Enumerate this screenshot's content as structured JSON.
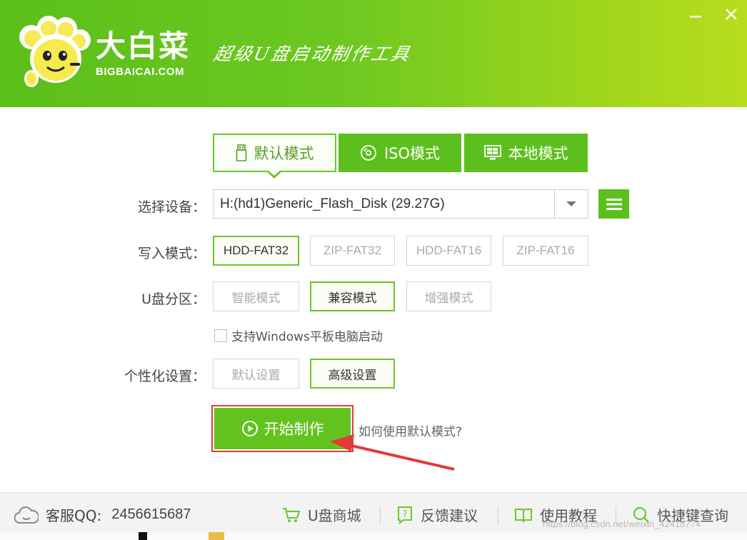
{
  "header": {
    "logo_cn": "大白菜",
    "logo_en": "BIGBAICAI.COM",
    "slogan": "超级U盘启动制作工具",
    "icons": {
      "minimize": "minimize-icon",
      "close": "close-icon"
    }
  },
  "tabs": [
    {
      "label": "默认模式",
      "icon": "usb-drive-icon",
      "selected": true
    },
    {
      "label": "ISO模式",
      "icon": "disc-icon",
      "selected": false
    },
    {
      "label": "本地模式",
      "icon": "monitor-icon",
      "selected": false
    }
  ],
  "device": {
    "label": "选择设备：",
    "value": "H:(hd1)Generic_Flash_Disk (29.27G)"
  },
  "write_mode": {
    "label": "写入模式：",
    "options": [
      "HDD-FAT32",
      "ZIP-FAT32",
      "HDD-FAT16",
      "ZIP-FAT16"
    ],
    "selected": "HDD-FAT32"
  },
  "partition": {
    "label": "U盘分区：",
    "options": [
      "智能模式",
      "兼容模式",
      "增强模式"
    ],
    "selected": "兼容模式"
  },
  "tablet_boot": {
    "label": "支持Windows平板电脑启动",
    "checked": false
  },
  "personalize": {
    "label": "个性化设置：",
    "options": [
      "默认设置",
      "高级设置"
    ],
    "selected": "高级设置"
  },
  "start_button": "开始制作",
  "help_link": "如何使用默认模式?",
  "footer": {
    "qq_label": "客服QQ:",
    "qq_number": "2456615687",
    "links": [
      {
        "label": "U盘商城",
        "icon": "cart-icon"
      },
      {
        "label": "反馈建议",
        "icon": "feedback-icon"
      },
      {
        "label": "使用教程",
        "icon": "book-icon"
      },
      {
        "label": "快捷键查询",
        "icon": "search-icon"
      }
    ]
  },
  "watermark": "https://blog.csdn.net/weixin_42418774",
  "colors": {
    "brand_green": "#5cbf1d",
    "annotation_red": "#e23a3a"
  }
}
